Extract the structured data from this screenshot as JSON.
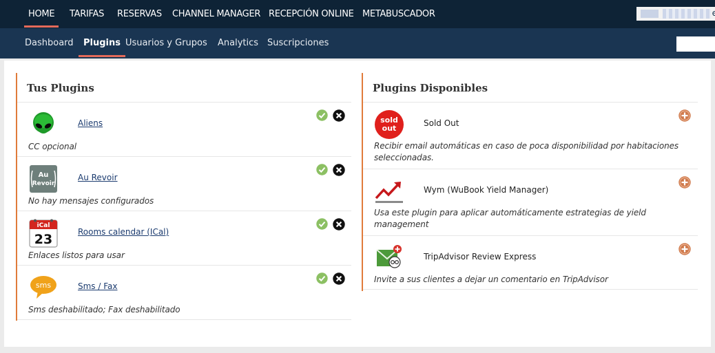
{
  "top_nav": {
    "items": [
      {
        "label": "HOME",
        "active": true
      },
      {
        "label": "TARIFAS",
        "active": false
      },
      {
        "label": "RESERVAS",
        "active": false
      },
      {
        "label": "CHANNEL MANAGER",
        "active": false
      },
      {
        "label": "RECEPCIÓN ONLINE",
        "active": false
      },
      {
        "label": "METABUSCADOR",
        "active": false
      }
    ],
    "user_fragment": "e"
  },
  "sub_nav": {
    "items": [
      {
        "label": "Dashboard",
        "active": false
      },
      {
        "label": "Plugins",
        "active": true
      },
      {
        "label": "Usuarios y Grupos",
        "active": false
      },
      {
        "label": "Analytics",
        "active": false
      },
      {
        "label": "Suscripciones",
        "active": false
      }
    ]
  },
  "my_plugins": {
    "title": "Tus Plugins",
    "items": [
      {
        "name": "Aliens",
        "description": "CC opcional",
        "icon": "alien-icon"
      },
      {
        "name": "Au Revoir",
        "description": "No hay mensajes configurados",
        "icon": "au-revoir-icon",
        "icon_text": [
          "Au",
          "Revoir"
        ]
      },
      {
        "name": "Rooms calendar (ICal)",
        "description": "Enlaces listos para usar",
        "icon": "ical-calendar-icon",
        "icon_text": [
          "iCal",
          "23"
        ]
      },
      {
        "name": "Sms / Fax",
        "description": "Sms deshabilitado; Fax deshabilitado",
        "icon": "sms-icon",
        "icon_text": [
          "sms"
        ]
      }
    ]
  },
  "available_plugins": {
    "title": "Plugins Disponibles",
    "items": [
      {
        "name": "Sold Out",
        "description": "Recibir email automáticas en caso de poca disponibilidad por habitaciones seleccionadas.",
        "icon": "sold-out-icon",
        "icon_text": [
          "sold",
          "out"
        ]
      },
      {
        "name": "Wym (WuBook Yield Manager)",
        "description": "Usa este plugin para aplicar automáticamente estrategias de yield management",
        "icon": "yield-chart-icon"
      },
      {
        "name": "TripAdvisor Review Express",
        "description": "Invite a sus clientes a dejar un comentario en TripAdvisor",
        "icon": "tripadvisor-mail-icon"
      }
    ]
  },
  "colors": {
    "top_bar": "#0e2336",
    "sub_bar": "#1a3552",
    "active_underline": "#e46a5a",
    "column_border": "#e07b3a",
    "ok_green": "#8cc063",
    "add_orange": "#d07a4c"
  }
}
